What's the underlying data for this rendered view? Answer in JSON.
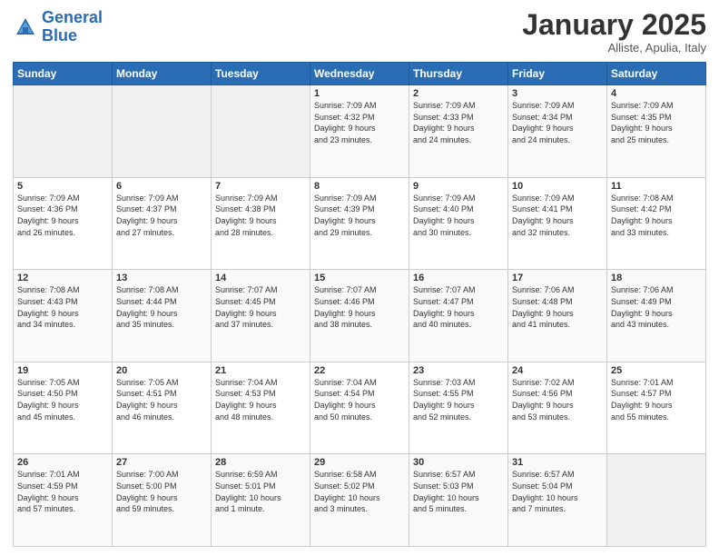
{
  "header": {
    "logo_line1": "General",
    "logo_line2": "Blue",
    "month_title": "January 2025",
    "location": "Alliste, Apulia, Italy"
  },
  "weekdays": [
    "Sunday",
    "Monday",
    "Tuesday",
    "Wednesday",
    "Thursday",
    "Friday",
    "Saturday"
  ],
  "weeks": [
    [
      {
        "day": "",
        "info": ""
      },
      {
        "day": "",
        "info": ""
      },
      {
        "day": "",
        "info": ""
      },
      {
        "day": "1",
        "info": "Sunrise: 7:09 AM\nSunset: 4:32 PM\nDaylight: 9 hours\nand 23 minutes."
      },
      {
        "day": "2",
        "info": "Sunrise: 7:09 AM\nSunset: 4:33 PM\nDaylight: 9 hours\nand 24 minutes."
      },
      {
        "day": "3",
        "info": "Sunrise: 7:09 AM\nSunset: 4:34 PM\nDaylight: 9 hours\nand 24 minutes."
      },
      {
        "day": "4",
        "info": "Sunrise: 7:09 AM\nSunset: 4:35 PM\nDaylight: 9 hours\nand 25 minutes."
      }
    ],
    [
      {
        "day": "5",
        "info": "Sunrise: 7:09 AM\nSunset: 4:36 PM\nDaylight: 9 hours\nand 26 minutes."
      },
      {
        "day": "6",
        "info": "Sunrise: 7:09 AM\nSunset: 4:37 PM\nDaylight: 9 hours\nand 27 minutes."
      },
      {
        "day": "7",
        "info": "Sunrise: 7:09 AM\nSunset: 4:38 PM\nDaylight: 9 hours\nand 28 minutes."
      },
      {
        "day": "8",
        "info": "Sunrise: 7:09 AM\nSunset: 4:39 PM\nDaylight: 9 hours\nand 29 minutes."
      },
      {
        "day": "9",
        "info": "Sunrise: 7:09 AM\nSunset: 4:40 PM\nDaylight: 9 hours\nand 30 minutes."
      },
      {
        "day": "10",
        "info": "Sunrise: 7:09 AM\nSunset: 4:41 PM\nDaylight: 9 hours\nand 32 minutes."
      },
      {
        "day": "11",
        "info": "Sunrise: 7:08 AM\nSunset: 4:42 PM\nDaylight: 9 hours\nand 33 minutes."
      }
    ],
    [
      {
        "day": "12",
        "info": "Sunrise: 7:08 AM\nSunset: 4:43 PM\nDaylight: 9 hours\nand 34 minutes."
      },
      {
        "day": "13",
        "info": "Sunrise: 7:08 AM\nSunset: 4:44 PM\nDaylight: 9 hours\nand 35 minutes."
      },
      {
        "day": "14",
        "info": "Sunrise: 7:07 AM\nSunset: 4:45 PM\nDaylight: 9 hours\nand 37 minutes."
      },
      {
        "day": "15",
        "info": "Sunrise: 7:07 AM\nSunset: 4:46 PM\nDaylight: 9 hours\nand 38 minutes."
      },
      {
        "day": "16",
        "info": "Sunrise: 7:07 AM\nSunset: 4:47 PM\nDaylight: 9 hours\nand 40 minutes."
      },
      {
        "day": "17",
        "info": "Sunrise: 7:06 AM\nSunset: 4:48 PM\nDaylight: 9 hours\nand 41 minutes."
      },
      {
        "day": "18",
        "info": "Sunrise: 7:06 AM\nSunset: 4:49 PM\nDaylight: 9 hours\nand 43 minutes."
      }
    ],
    [
      {
        "day": "19",
        "info": "Sunrise: 7:05 AM\nSunset: 4:50 PM\nDaylight: 9 hours\nand 45 minutes."
      },
      {
        "day": "20",
        "info": "Sunrise: 7:05 AM\nSunset: 4:51 PM\nDaylight: 9 hours\nand 46 minutes."
      },
      {
        "day": "21",
        "info": "Sunrise: 7:04 AM\nSunset: 4:53 PM\nDaylight: 9 hours\nand 48 minutes."
      },
      {
        "day": "22",
        "info": "Sunrise: 7:04 AM\nSunset: 4:54 PM\nDaylight: 9 hours\nand 50 minutes."
      },
      {
        "day": "23",
        "info": "Sunrise: 7:03 AM\nSunset: 4:55 PM\nDaylight: 9 hours\nand 52 minutes."
      },
      {
        "day": "24",
        "info": "Sunrise: 7:02 AM\nSunset: 4:56 PM\nDaylight: 9 hours\nand 53 minutes."
      },
      {
        "day": "25",
        "info": "Sunrise: 7:01 AM\nSunset: 4:57 PM\nDaylight: 9 hours\nand 55 minutes."
      }
    ],
    [
      {
        "day": "26",
        "info": "Sunrise: 7:01 AM\nSunset: 4:59 PM\nDaylight: 9 hours\nand 57 minutes."
      },
      {
        "day": "27",
        "info": "Sunrise: 7:00 AM\nSunset: 5:00 PM\nDaylight: 9 hours\nand 59 minutes."
      },
      {
        "day": "28",
        "info": "Sunrise: 6:59 AM\nSunset: 5:01 PM\nDaylight: 10 hours\nand 1 minute."
      },
      {
        "day": "29",
        "info": "Sunrise: 6:58 AM\nSunset: 5:02 PM\nDaylight: 10 hours\nand 3 minutes."
      },
      {
        "day": "30",
        "info": "Sunrise: 6:57 AM\nSunset: 5:03 PM\nDaylight: 10 hours\nand 5 minutes."
      },
      {
        "day": "31",
        "info": "Sunrise: 6:57 AM\nSunset: 5:04 PM\nDaylight: 10 hours\nand 7 minutes."
      },
      {
        "day": "",
        "info": ""
      }
    ]
  ]
}
